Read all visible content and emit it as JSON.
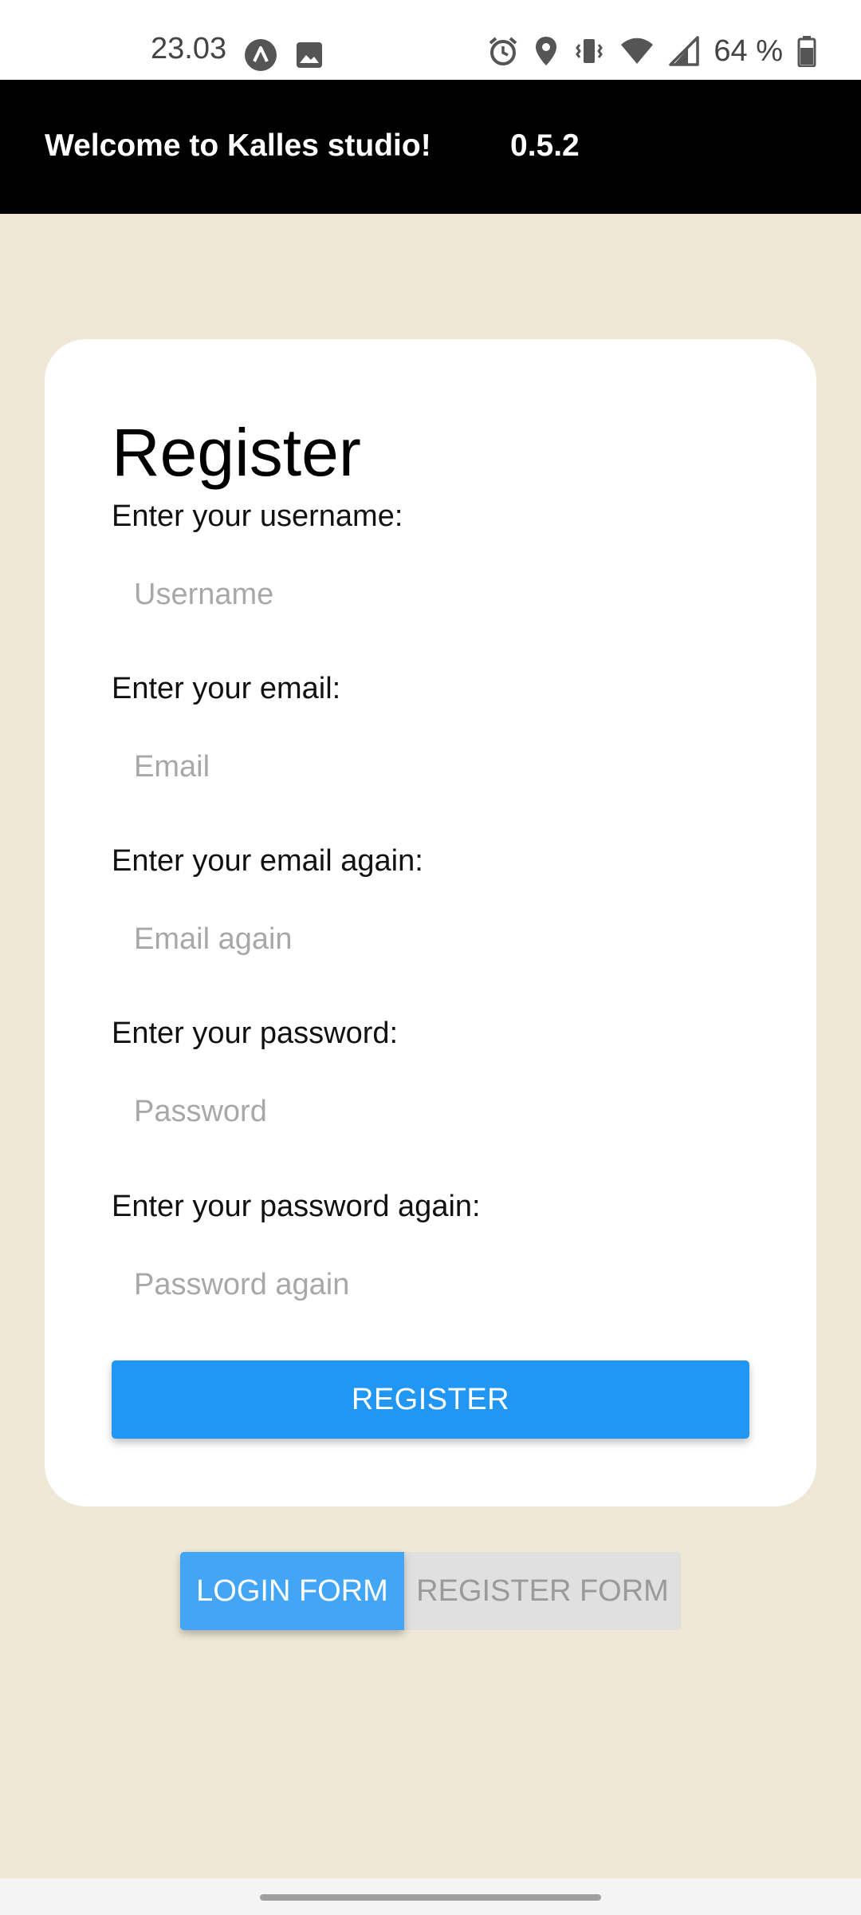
{
  "status_bar": {
    "time": "23.03",
    "battery_text": "64 %",
    "icons": [
      "app-a-icon",
      "image-icon",
      "alarm-icon",
      "location-icon",
      "vibrate-icon",
      "wifi-icon",
      "signal-icon",
      "battery-icon"
    ]
  },
  "header": {
    "title": "Welcome to Kalles studio!",
    "version": "0.5.2"
  },
  "form": {
    "title": "Register",
    "fields": [
      {
        "label": "Enter your username:",
        "placeholder": "Username",
        "value": ""
      },
      {
        "label": "Enter your email:",
        "placeholder": "Email",
        "value": ""
      },
      {
        "label": "Enter your email again:",
        "placeholder": "Email again",
        "value": ""
      },
      {
        "label": "Enter your password:",
        "placeholder": "Password",
        "value": ""
      },
      {
        "label": "Enter your password again:",
        "placeholder": "Password again",
        "value": ""
      }
    ],
    "submit_label": "REGISTER"
  },
  "toggle": {
    "login_label": "LOGIN FORM",
    "register_label": "REGISTER FORM"
  },
  "colors": {
    "background": "#efe8d6",
    "header": "#000000",
    "primary": "#2196f3",
    "toggle_active": "#42a5f5",
    "toggle_inactive": "#e0e0e0"
  }
}
